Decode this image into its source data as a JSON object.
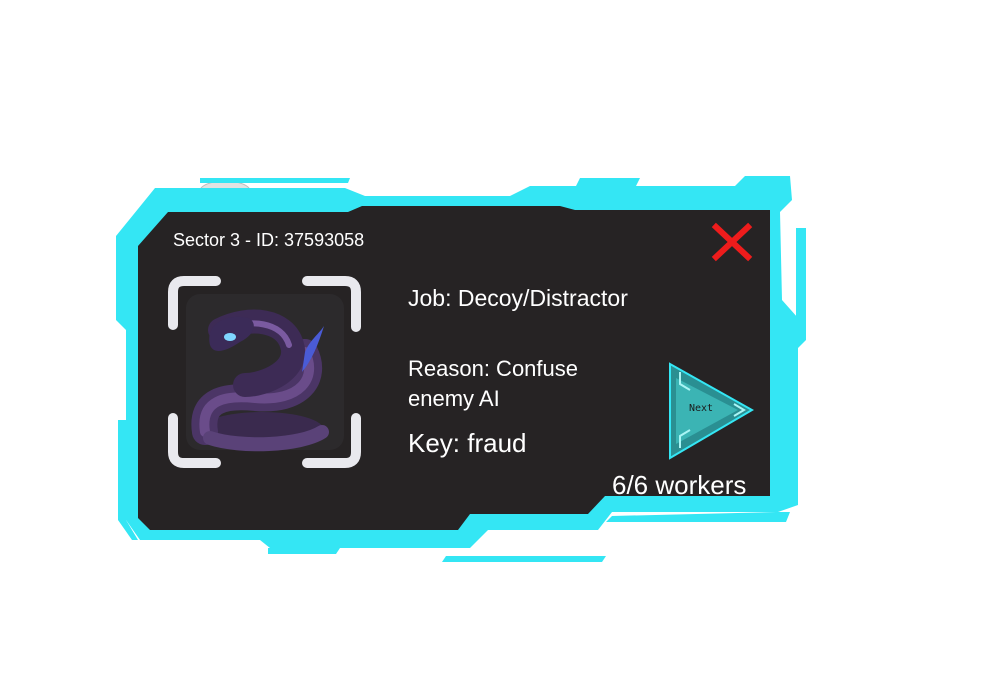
{
  "worker_card": {
    "sector_id": "Sector 3 - ID:  37593058",
    "job": "Job: Decoy/Distractor",
    "reason": "Reason: Confuse enemy AI",
    "key": "Key: fraud",
    "workers": "6/6 workers",
    "next_label": "Next",
    "portrait_icon": "purple-serpent-icon",
    "close_icon": "red-x-close-icon"
  },
  "colors": {
    "frame_accent": "#34e6f4",
    "panel_bg": "#262324",
    "close_red": "#ee1c1c",
    "next_teal": "#2a9b9b",
    "corner_brackets": "#e9e9ee",
    "text": "#ffffff"
  }
}
